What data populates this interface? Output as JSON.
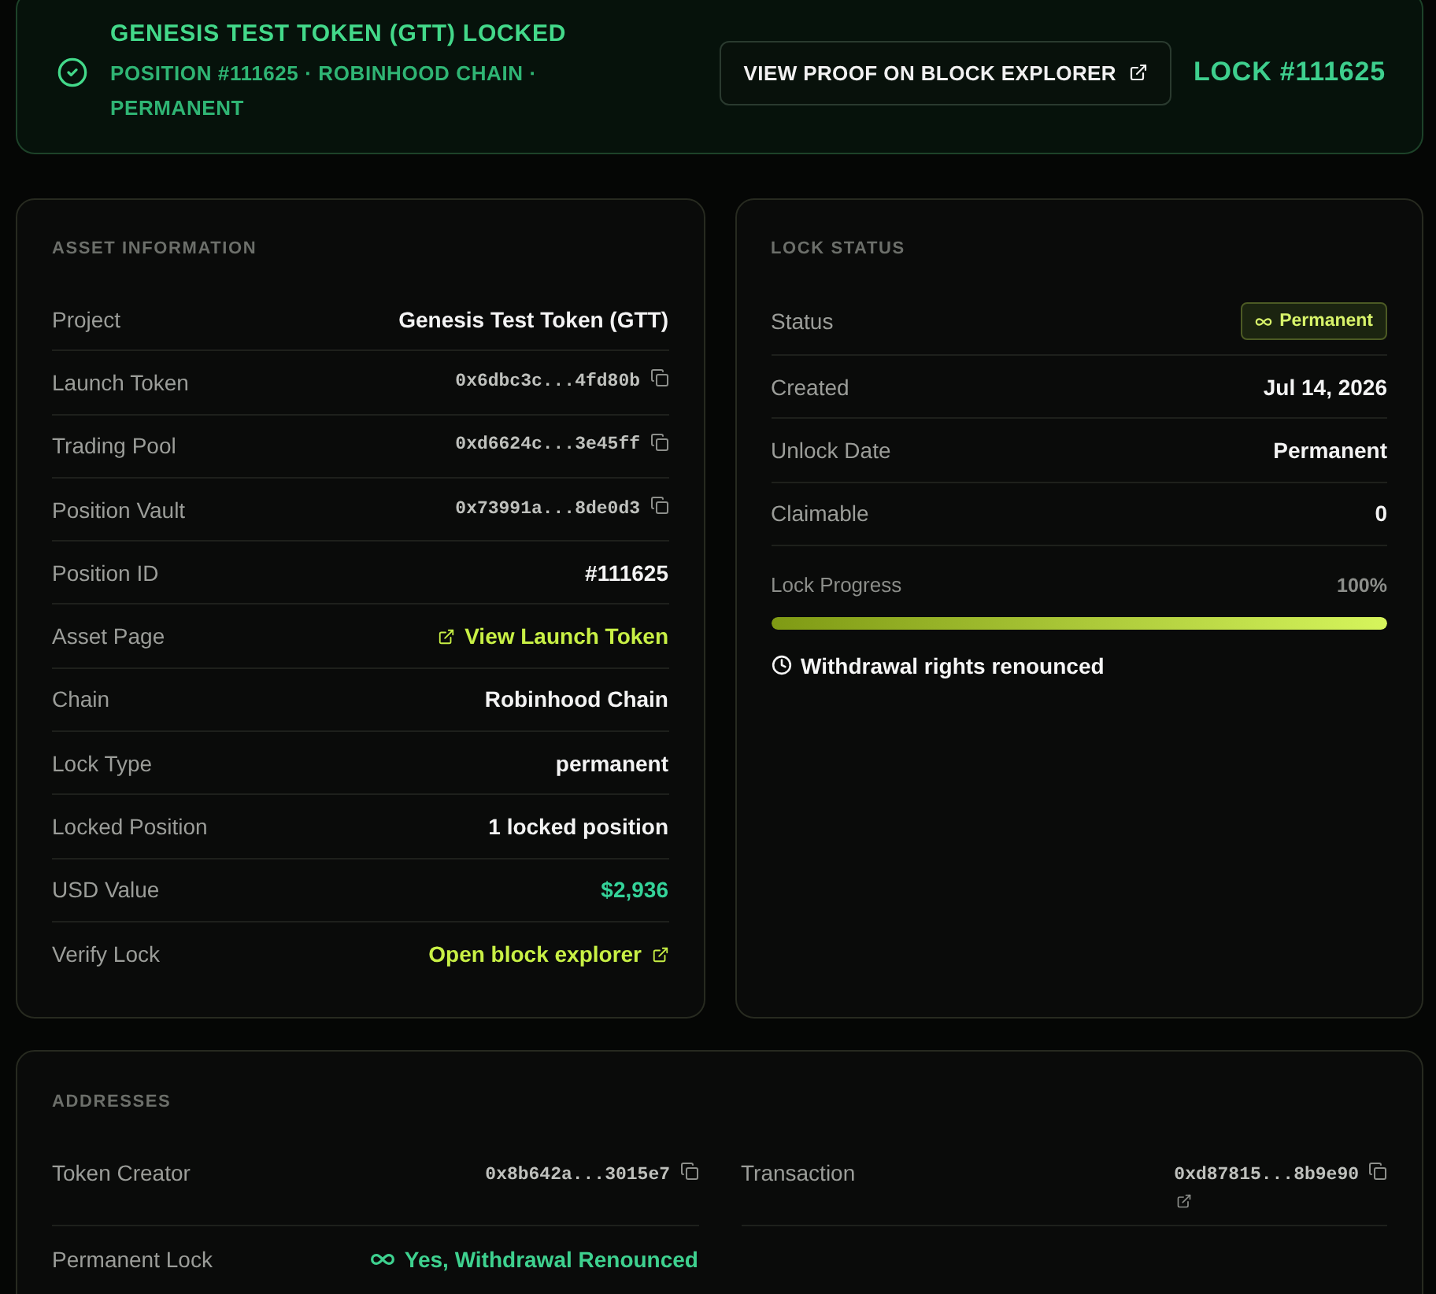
{
  "banner": {
    "title": "GENESIS TEST TOKEN (GTT) LOCKED",
    "subtitle": "POSITION #111625 · ROBINHOOD CHAIN · PERMANENT",
    "button": "VIEW PROOF ON BLOCK EXPLORER",
    "lock_id": "LOCK #111625"
  },
  "asset_information": {
    "heading": "ASSET INFORMATION",
    "rows": [
      {
        "label": "Project",
        "value": "Genesis Test Token (GTT)",
        "kind": "text"
      },
      {
        "label": "Launch Token",
        "value": "0x6dbc3c...4fd80b",
        "kind": "address"
      },
      {
        "label": "Trading Pool",
        "value": "0xd6624c...3e45ff",
        "kind": "address"
      },
      {
        "label": "Position Vault",
        "value": "0x73991a...8de0d3",
        "kind": "address"
      },
      {
        "label": "Position ID",
        "value": "#111625",
        "kind": "text"
      },
      {
        "label": "Asset Page",
        "value": "View Launch Token",
        "kind": "page_link"
      },
      {
        "label": "Chain",
        "value": "Robinhood Chain",
        "kind": "text"
      },
      {
        "label": "Lock Type",
        "value": "permanent",
        "kind": "text"
      },
      {
        "label": "Locked Position",
        "value": "1 locked position",
        "kind": "text"
      },
      {
        "label": "USD Value",
        "value": "$2,936",
        "kind": "amount"
      },
      {
        "label": "Verify Lock",
        "value": "Open block explorer",
        "kind": "explorer_link"
      }
    ]
  },
  "lock_status": {
    "heading": "LOCK STATUS",
    "rows": [
      {
        "label": "Status",
        "value": "Permanent",
        "kind": "badge"
      },
      {
        "label": "Created",
        "value": "Jul 14, 2026",
        "kind": "text"
      },
      {
        "label": "Unlock Date",
        "value": "Permanent",
        "kind": "text"
      },
      {
        "label": "Claimable",
        "value": "0",
        "kind": "text"
      }
    ],
    "progress": {
      "label": "Lock Progress",
      "reading": "100%",
      "level": 1
    },
    "note": "Withdrawal rights renounced"
  },
  "addresses": {
    "heading": "ADDRESSES",
    "items": [
      {
        "label": "Token Creator",
        "value": "0x8b642a...3015e7",
        "kind": "address"
      },
      {
        "label": "Transaction",
        "value": "0xd87815...8b9e90",
        "kind": "transaction"
      },
      {
        "label": "Permanent Lock",
        "value": "Yes, Withdrawal Renounced",
        "kind": "status"
      }
    ]
  }
}
